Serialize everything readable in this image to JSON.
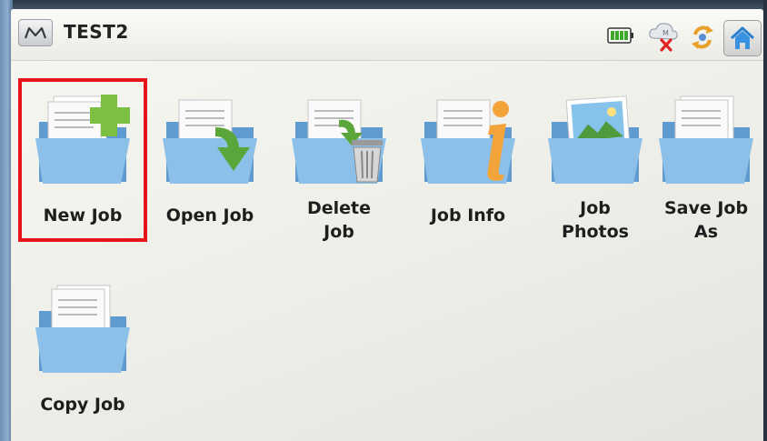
{
  "titlebar": {
    "menu_icon": "m-logo-icon",
    "job_name": "TEST2"
  },
  "status": {
    "battery": "battery-icon",
    "connection": "no-connection-cloud-icon",
    "sync": "sync-icon",
    "home": "home-icon"
  },
  "tiles": [
    {
      "line1": "New Job",
      "line2": "",
      "icon": "new-job-folder-icon"
    },
    {
      "line1": "Open Job",
      "line2": "",
      "icon": "open-job-folder-icon"
    },
    {
      "line1": "Delete",
      "line2": "Job",
      "icon": "delete-job-folder-icon"
    },
    {
      "line1": "Job Info",
      "line2": "",
      "icon": "job-info-folder-icon"
    },
    {
      "line1": "Job",
      "line2": "Photos",
      "icon": "job-photos-folder-icon"
    },
    {
      "line1": "Save Job",
      "line2": "As",
      "icon": "save-job-as-folder-icon"
    },
    {
      "line1": "Copy Job",
      "line2": "",
      "icon": "copy-job-folder-icon"
    }
  ],
  "colors": {
    "highlight": "#e8141a",
    "folder": "#7eb3df",
    "plus": "#7bc043",
    "arrow": "#5aa63a",
    "info": "#f2a33a"
  }
}
